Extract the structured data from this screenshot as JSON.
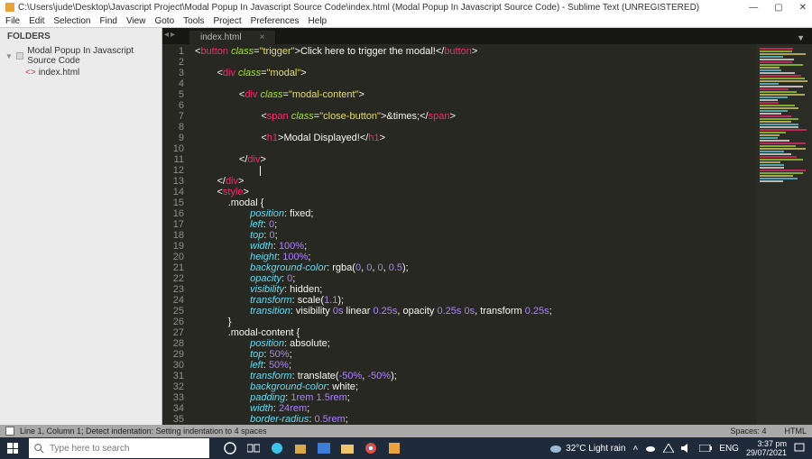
{
  "window": {
    "title": "C:\\Users\\jude\\Desktop\\Javascript Project\\Modal Popup In Javascript Source Code\\index.html (Modal Popup In Javascript Source Code) - Sublime Text (UNREGISTERED)"
  },
  "menu": [
    "File",
    "Edit",
    "Selection",
    "Find",
    "View",
    "Goto",
    "Tools",
    "Project",
    "Preferences",
    "Help"
  ],
  "sidebar": {
    "header": "FOLDERS",
    "folder": "Modal Popup In Javascript Source Code",
    "file": "index.html"
  },
  "tab": {
    "name": "index.html",
    "close": "×"
  },
  "code": {
    "lines": [
      {
        "n": 1,
        "seg": [
          [
            "pun",
            "<"
          ],
          [
            "tag",
            "button"
          ],
          [
            "txt",
            " "
          ],
          [
            "attr",
            "class"
          ],
          [
            "pun",
            "="
          ],
          [
            "str",
            "\"trigger\""
          ],
          [
            "pun",
            ">"
          ],
          [
            "txt",
            "Click here to trigger the modal!"
          ],
          [
            "pun",
            "</"
          ],
          [
            "tag",
            "button"
          ],
          [
            "pun",
            ">"
          ]
        ],
        "indent": 0
      },
      {
        "n": 2,
        "seg": [],
        "indent": 0
      },
      {
        "n": 3,
        "seg": [
          [
            "pun",
            "<"
          ],
          [
            "tag",
            "div"
          ],
          [
            "txt",
            " "
          ],
          [
            "attr",
            "class"
          ],
          [
            "pun",
            "="
          ],
          [
            "str",
            "\"modal\""
          ],
          [
            "pun",
            ">"
          ]
        ],
        "indent": 2
      },
      {
        "n": 4,
        "seg": [],
        "indent": 0
      },
      {
        "n": 5,
        "seg": [
          [
            "pun",
            "<"
          ],
          [
            "tag",
            "div"
          ],
          [
            "txt",
            " "
          ],
          [
            "attr",
            "class"
          ],
          [
            "pun",
            "="
          ],
          [
            "str",
            "\"modal-content\""
          ],
          [
            "pun",
            ">"
          ]
        ],
        "indent": 4
      },
      {
        "n": 6,
        "seg": [],
        "indent": 0
      },
      {
        "n": 7,
        "seg": [
          [
            "pun",
            "<"
          ],
          [
            "tag",
            "span"
          ],
          [
            "txt",
            " "
          ],
          [
            "attr",
            "class"
          ],
          [
            "pun",
            "="
          ],
          [
            "str",
            "\"close-button\""
          ],
          [
            "pun",
            ">"
          ],
          [
            "txt",
            "&times;"
          ],
          [
            "pun",
            "</"
          ],
          [
            "tag",
            "span"
          ],
          [
            "pun",
            ">"
          ]
        ],
        "indent": 6
      },
      {
        "n": 8,
        "seg": [],
        "indent": 0
      },
      {
        "n": 9,
        "seg": [
          [
            "pun",
            "<"
          ],
          [
            "tag",
            "h1"
          ],
          [
            "pun",
            ">"
          ],
          [
            "txt",
            "Modal Displayed!"
          ],
          [
            "pun",
            "</"
          ],
          [
            "tag",
            "h1"
          ],
          [
            "pun",
            ">"
          ]
        ],
        "indent": 6
      },
      {
        "n": 10,
        "seg": [],
        "indent": 0
      },
      {
        "n": 11,
        "seg": [
          [
            "pun",
            "</"
          ],
          [
            "tag",
            "div"
          ],
          [
            "pun",
            ">"
          ]
        ],
        "indent": 4
      },
      {
        "n": 12,
        "seg": [],
        "indent": 0
      },
      {
        "n": 13,
        "seg": [
          [
            "pun",
            "</"
          ],
          [
            "tag",
            "div"
          ],
          [
            "pun",
            ">"
          ]
        ],
        "indent": 2
      },
      {
        "n": 14,
        "seg": [
          [
            "pun",
            "<"
          ],
          [
            "tag",
            "style"
          ],
          [
            "pun",
            ">"
          ]
        ],
        "indent": 2
      },
      {
        "n": 15,
        "seg": [
          [
            "txt",
            ".modal {"
          ]
        ],
        "indent": 3,
        "css": true
      },
      {
        "n": 16,
        "seg": [
          [
            "prop",
            "position"
          ],
          [
            "pun",
            ": "
          ],
          [
            "txt",
            "fixed"
          ],
          [
            "pun",
            ";"
          ]
        ],
        "indent": 5
      },
      {
        "n": 17,
        "seg": [
          [
            "prop",
            "left"
          ],
          [
            "pun",
            ": "
          ],
          [
            "val",
            "0"
          ],
          [
            "pun",
            ";"
          ]
        ],
        "indent": 5
      },
      {
        "n": 18,
        "seg": [
          [
            "prop",
            "top"
          ],
          [
            "pun",
            ": "
          ],
          [
            "val",
            "0"
          ],
          [
            "pun",
            ";"
          ]
        ],
        "indent": 5
      },
      {
        "n": 19,
        "seg": [
          [
            "prop",
            "width"
          ],
          [
            "pun",
            ": "
          ],
          [
            "val",
            "100%"
          ],
          [
            "pun",
            ";"
          ]
        ],
        "indent": 5
      },
      {
        "n": 20,
        "seg": [
          [
            "prop",
            "height"
          ],
          [
            "pun",
            ": "
          ],
          [
            "val",
            "100%"
          ],
          [
            "pun",
            ";"
          ]
        ],
        "indent": 5
      },
      {
        "n": 21,
        "seg": [
          [
            "prop",
            "background-color"
          ],
          [
            "pun",
            ": "
          ],
          [
            "txt",
            "rgba("
          ],
          [
            "val",
            "0"
          ],
          [
            "pun",
            ", "
          ],
          [
            "val",
            "0"
          ],
          [
            "pun",
            ", "
          ],
          [
            "val",
            "0"
          ],
          [
            "pun",
            ", "
          ],
          [
            "val",
            "0.5"
          ],
          [
            "pun",
            ");"
          ]
        ],
        "indent": 5
      },
      {
        "n": 22,
        "seg": [
          [
            "prop",
            "opacity"
          ],
          [
            "pun",
            ": "
          ],
          [
            "val",
            "0"
          ],
          [
            "pun",
            ";"
          ]
        ],
        "indent": 5
      },
      {
        "n": 23,
        "seg": [
          [
            "prop",
            "visibility"
          ],
          [
            "pun",
            ": "
          ],
          [
            "txt",
            "hidden"
          ],
          [
            "pun",
            ";"
          ]
        ],
        "indent": 5
      },
      {
        "n": 24,
        "seg": [
          [
            "prop",
            "transform"
          ],
          [
            "pun",
            ": "
          ],
          [
            "txt",
            "scale("
          ],
          [
            "val",
            "1.1"
          ],
          [
            "pun",
            ");"
          ]
        ],
        "indent": 5
      },
      {
        "n": 25,
        "seg": [
          [
            "prop",
            "transition"
          ],
          [
            "pun",
            ": "
          ],
          [
            "txt",
            "visibility "
          ],
          [
            "val",
            "0s"
          ],
          [
            "txt",
            " linear "
          ],
          [
            "val",
            "0.25s"
          ],
          [
            "pun",
            ", "
          ],
          [
            "txt",
            "opacity "
          ],
          [
            "val",
            "0.25s"
          ],
          [
            "txt",
            " "
          ],
          [
            "val",
            "0s"
          ],
          [
            "pun",
            ", "
          ],
          [
            "txt",
            "transform "
          ],
          [
            "val",
            "0.25s"
          ],
          [
            "pun",
            ";"
          ]
        ],
        "indent": 5
      },
      {
        "n": 26,
        "seg": [
          [
            "pun",
            "}"
          ]
        ],
        "indent": 3
      },
      {
        "n": 27,
        "seg": [
          [
            "txt",
            ".modal-content {"
          ]
        ],
        "indent": 3,
        "css": true
      },
      {
        "n": 28,
        "seg": [
          [
            "prop",
            "position"
          ],
          [
            "pun",
            ": "
          ],
          [
            "txt",
            "absolute"
          ],
          [
            "pun",
            ";"
          ]
        ],
        "indent": 5
      },
      {
        "n": 29,
        "seg": [
          [
            "prop",
            "top"
          ],
          [
            "pun",
            ": "
          ],
          [
            "val",
            "50%"
          ],
          [
            "pun",
            ";"
          ]
        ],
        "indent": 5
      },
      {
        "n": 30,
        "seg": [
          [
            "prop",
            "left"
          ],
          [
            "pun",
            ": "
          ],
          [
            "val",
            "50%"
          ],
          [
            "pun",
            ";"
          ]
        ],
        "indent": 5
      },
      {
        "n": 31,
        "seg": [
          [
            "prop",
            "transform"
          ],
          [
            "pun",
            ": "
          ],
          [
            "txt",
            "translate("
          ],
          [
            "val",
            "-50%"
          ],
          [
            "pun",
            ", "
          ],
          [
            "val",
            "-50%"
          ],
          [
            "pun",
            ");"
          ]
        ],
        "indent": 5
      },
      {
        "n": 32,
        "seg": [
          [
            "prop",
            "background-color"
          ],
          [
            "pun",
            ": "
          ],
          [
            "txt",
            "white"
          ],
          [
            "pun",
            ";"
          ]
        ],
        "indent": 5
      },
      {
        "n": 33,
        "seg": [
          [
            "prop",
            "padding"
          ],
          [
            "pun",
            ": "
          ],
          [
            "val",
            "1rem"
          ],
          [
            "txt",
            " "
          ],
          [
            "val",
            "1.5rem"
          ],
          [
            "pun",
            ";"
          ]
        ],
        "indent": 5
      },
      {
        "n": 34,
        "seg": [
          [
            "prop",
            "width"
          ],
          [
            "pun",
            ": "
          ],
          [
            "val",
            "24rem"
          ],
          [
            "pun",
            ";"
          ]
        ],
        "indent": 5
      },
      {
        "n": 35,
        "seg": [
          [
            "prop",
            "border-radius"
          ],
          [
            "pun",
            ": "
          ],
          [
            "val",
            "0.5rem"
          ],
          [
            "pun",
            ";"
          ]
        ],
        "indent": 5
      }
    ]
  },
  "status": {
    "left": "Line 1, Column 1; Detect indentation: Setting indentation to 4 spaces",
    "spaces": "Spaces: 4",
    "lang": "HTML"
  },
  "taskbar": {
    "search_placeholder": "Type here to search",
    "weather": "32°C  Light rain",
    "lang": "ENG",
    "time": "3:37 pm",
    "date": "29/07/2021"
  }
}
